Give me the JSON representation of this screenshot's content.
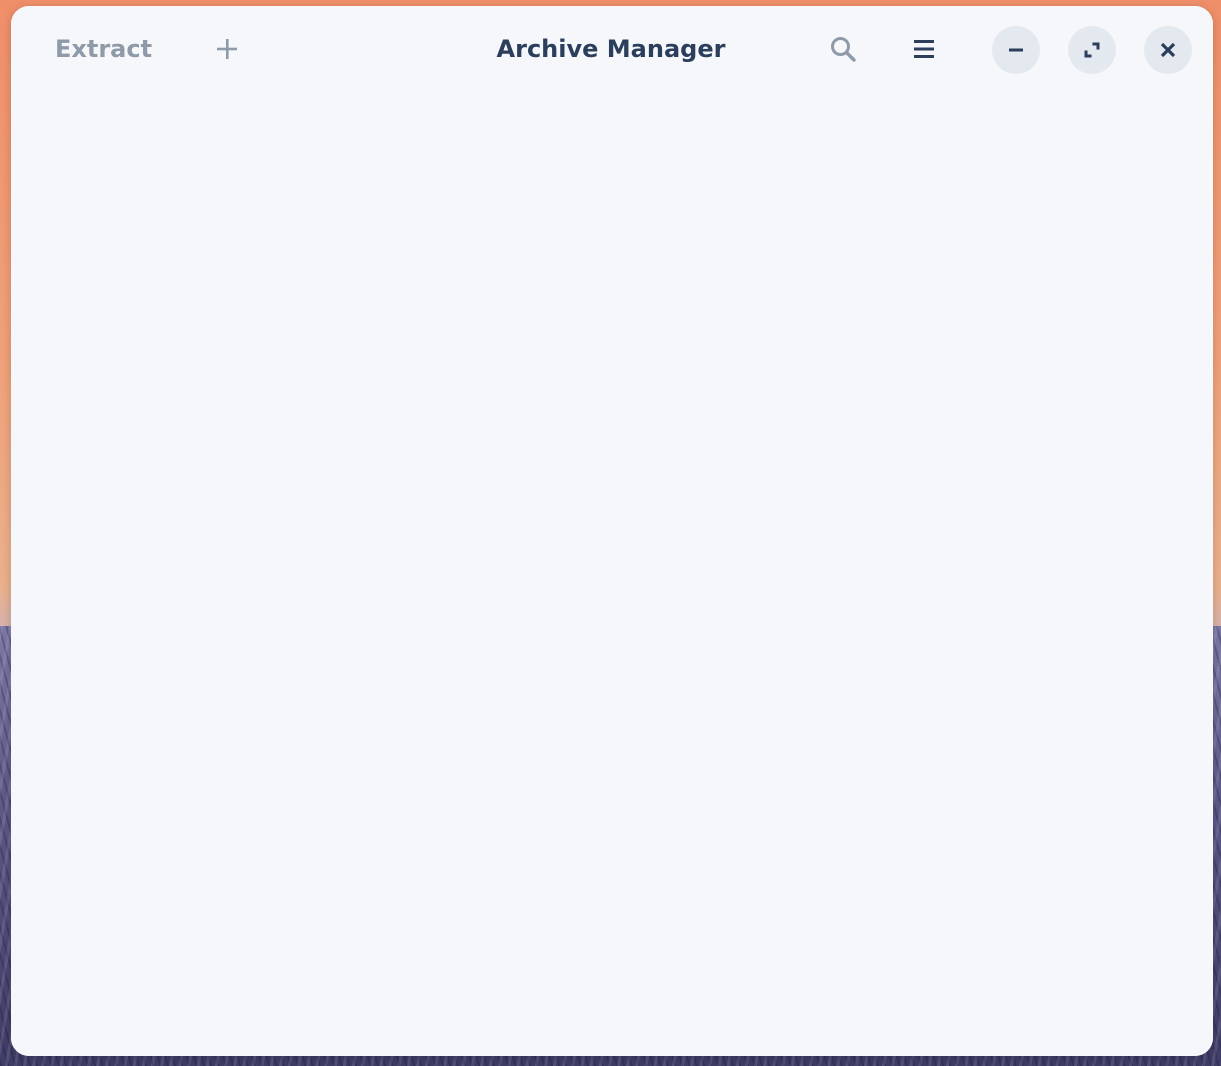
{
  "window": {
    "title": "Archive Manager"
  },
  "headerbar": {
    "extract_label": "Extract",
    "add_icon": "plus-icon",
    "search_icon": "search-icon",
    "menu_icon": "hamburger-menu-icon",
    "minimize_icon": "minimize-icon",
    "maximize_icon": "maximize-icon",
    "close_icon": "close-icon"
  },
  "colors": {
    "window_background": "#f5f7fb",
    "title_text": "#2b3f5c",
    "disabled_text": "#8f9aa9",
    "window_button_background": "#e4e8ef"
  }
}
